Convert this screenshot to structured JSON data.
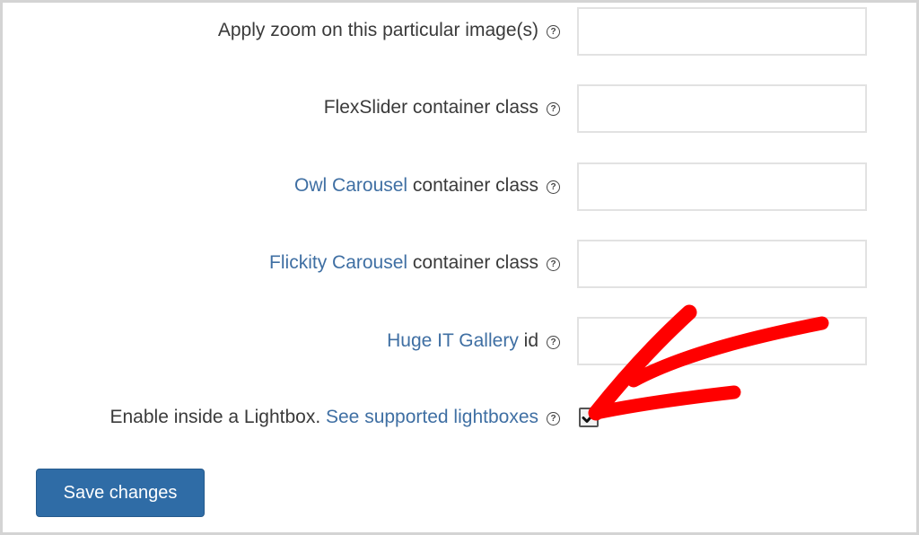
{
  "settings": {
    "rows": [
      {
        "link": "",
        "label": "Apply zoom on this particular image(s)",
        "help": "?",
        "value": ""
      },
      {
        "link": "",
        "label": "FlexSlider container class",
        "help": "?",
        "value": ""
      },
      {
        "link": "Owl Carousel",
        "label": " container class",
        "help": "?",
        "value": ""
      },
      {
        "link": "Flickity Carousel",
        "label": " container class",
        "help": "?",
        "value": ""
      },
      {
        "link": "Huge IT Gallery",
        "label": " id",
        "help": "?",
        "value": ""
      }
    ],
    "lightbox": {
      "label": "Enable inside a Lightbox. ",
      "link": "See supported lightboxes",
      "help": "?",
      "checked": true
    },
    "save_label": "Save changes"
  },
  "annotation": {
    "type": "red-arrow",
    "points_to": "lightbox-checkbox",
    "color": "#ff0000"
  },
  "colors": {
    "link": "#3f6fa3",
    "button": "#2f6ca6",
    "text": "#3a3a3a"
  }
}
